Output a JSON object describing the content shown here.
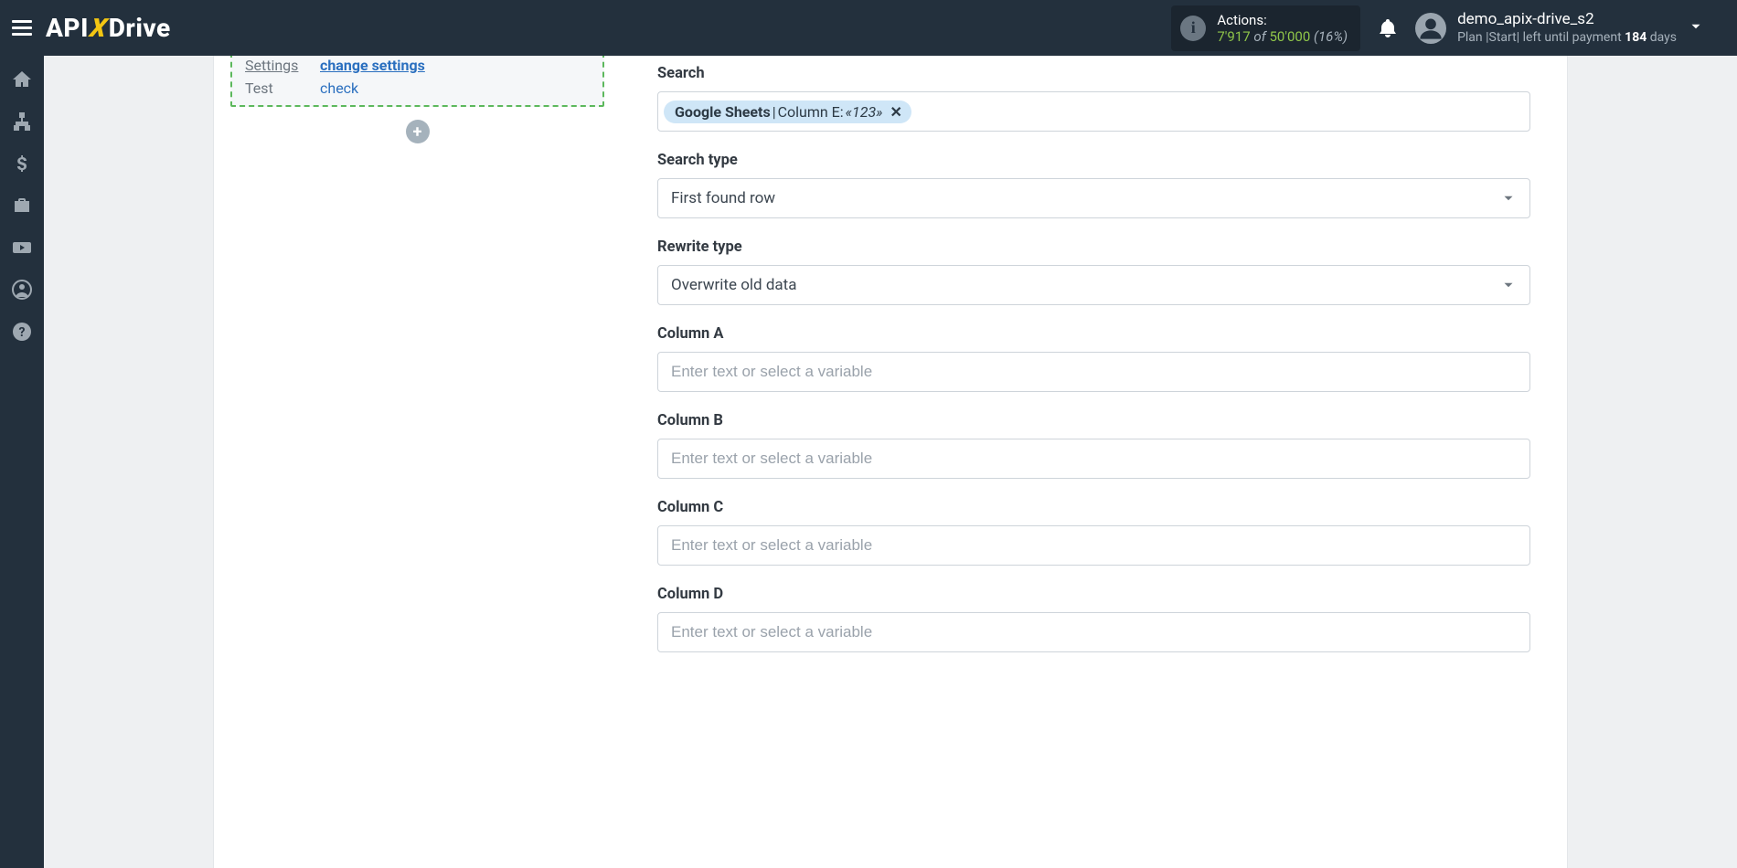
{
  "header": {
    "logo": {
      "part1": "API",
      "x": "X",
      "part2": "Drive"
    },
    "actions": {
      "label": "Actions:",
      "used": "7'917",
      "of": "of",
      "limit": "50'000",
      "pct": "(16%)"
    },
    "user": {
      "name": "demo_apix-drive_s2",
      "plan_prefix": "Plan |Start| left until payment ",
      "days": "184",
      "days_suffix": " days"
    }
  },
  "leftcard": {
    "rows": [
      {
        "k": "Settings",
        "v": "change settings",
        "ku": true,
        "vbold": true
      },
      {
        "k": "Test",
        "v": "check"
      }
    ]
  },
  "form": {
    "search_label": "Search",
    "search_tag": {
      "source": "Google Sheets",
      "sep": " | ",
      "column": "Column E: ",
      "value": "«123»"
    },
    "search_type_label": "Search type",
    "search_type_value": "First found row",
    "rewrite_label": "Rewrite type",
    "rewrite_value": "Overwrite old data",
    "placeholder": "Enter text or select a variable",
    "columns": [
      {
        "label": "Column A"
      },
      {
        "label": "Column B"
      },
      {
        "label": "Column C"
      },
      {
        "label": "Column D"
      }
    ]
  }
}
